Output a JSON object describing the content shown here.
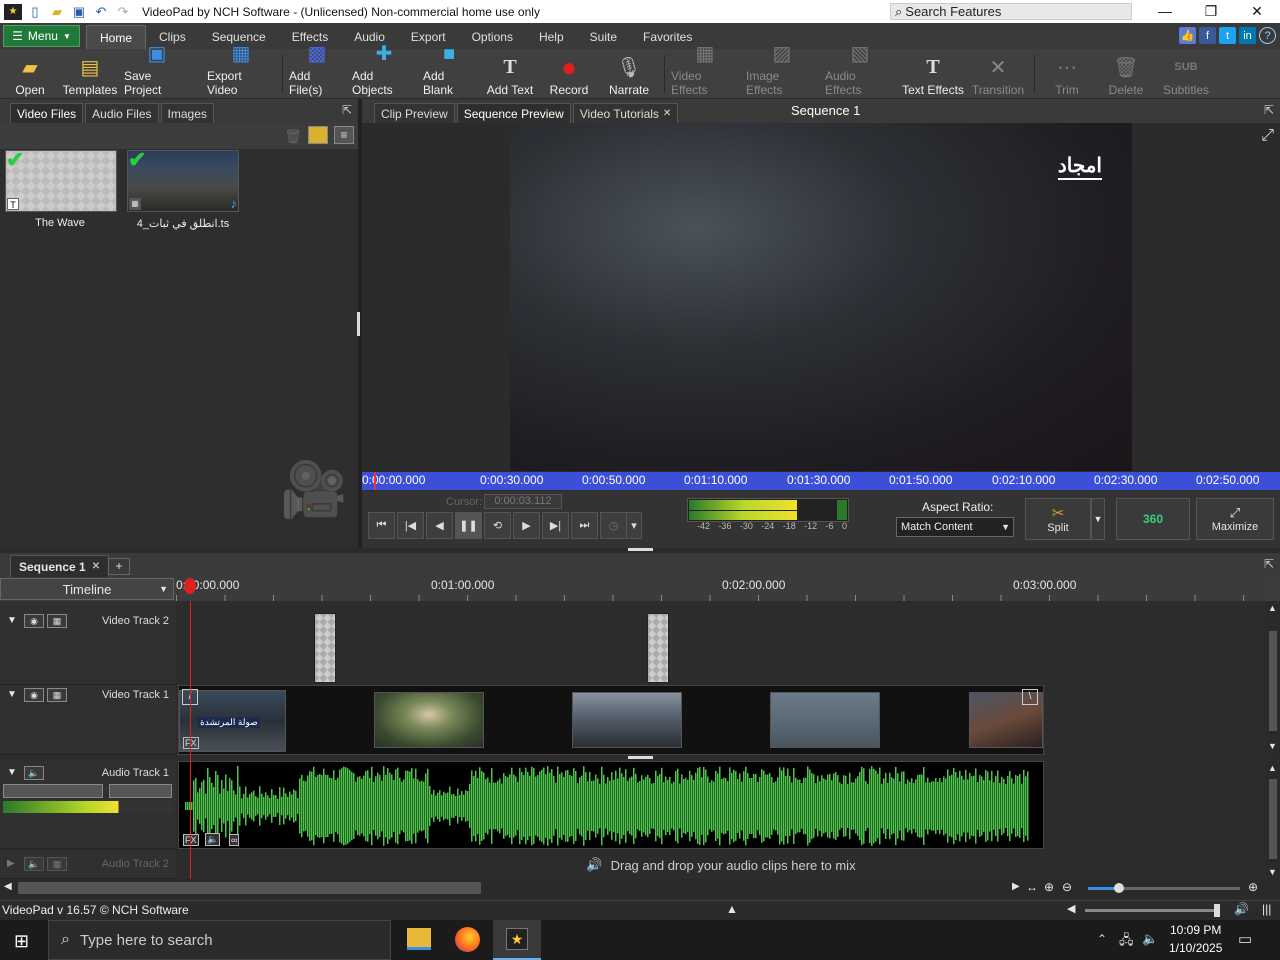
{
  "window": {
    "title": "VideoPad by NCH Software - (Unlicensed) Non-commercial home use only",
    "search_placeholder": "Search Features"
  },
  "menu": {
    "menu_label": "Menu",
    "tabs": [
      "Home",
      "Clips",
      "Sequence",
      "Effects",
      "Audio",
      "Export",
      "Options",
      "Help",
      "Suite",
      "Favorites"
    ],
    "active_tab": "Home"
  },
  "toolbar": {
    "open": "Open",
    "templates": "Templates",
    "save_project": "Save Project",
    "export_video": "Export Video",
    "add_files": "Add File(s)",
    "add_objects": "Add Objects",
    "add_blank": "Add Blank",
    "add_text": "Add Text",
    "record": "Record",
    "narrate": "Narrate",
    "video_effects": "Video Effects",
    "image_effects": "Image Effects",
    "audio_effects": "Audio Effects",
    "text_effects": "Text Effects",
    "transition": "Transition",
    "trim": "Trim",
    "delete": "Delete",
    "subtitles": "Subtitles",
    "subtitles_icon_text": "SUB"
  },
  "bin": {
    "tabs": [
      "Video Files",
      "Audio Files",
      "Images"
    ],
    "files": [
      {
        "name": "The Wave",
        "type": "text-clip"
      },
      {
        "name": "4_انطلق في ثبات.ts",
        "type": "video-clip"
      }
    ]
  },
  "preview": {
    "tabs": [
      "Clip Preview",
      "Sequence Preview",
      "Video Tutorials"
    ],
    "active_tab": "Sequence Preview",
    "sequence_title": "Sequence 1",
    "watermark": "امجاد",
    "ruler_labels": [
      "0:00:00.000",
      "0:00:30.000",
      "0:00:50.000",
      "0:01:10.000",
      "0:01:30.000",
      "0:01:50.000",
      "0:02:10.000",
      "0:02:30.000",
      "0:02:50.000"
    ],
    "cursor_label": "Cursor:",
    "cursor_time": "0:00:03.112",
    "meter_labels": [
      "-42",
      "-36",
      "-30",
      "-24",
      "-18",
      "-12",
      "-6",
      "0"
    ],
    "aspect_label": "Aspect Ratio:",
    "aspect_value": "Match Content",
    "split": "Split",
    "vr360": "360",
    "maximize": "Maximize"
  },
  "sequence": {
    "tab": "Sequence 1",
    "add_tab": "+",
    "view_mode": "Timeline",
    "time_labels": [
      "0:00:00.000",
      "0:01:00.000",
      "0:02:00.000",
      "0:03:00.000"
    ],
    "fx_label": "FX",
    "tracks": [
      {
        "name": "Video Track 2"
      },
      {
        "name": "Video Track 1"
      },
      {
        "name": "Audio Track 1"
      },
      {
        "name": "Audio Track 2"
      }
    ],
    "clip1_text": "صولة المرتشدة",
    "drop_hint": "Drag and drop your audio clips here to mix"
  },
  "status": {
    "version": "VideoPad v 16.57 © NCH Software"
  },
  "taskbar": {
    "search_placeholder": "Type here to search",
    "time": "10:09 PM",
    "date": "1/10/2025"
  }
}
